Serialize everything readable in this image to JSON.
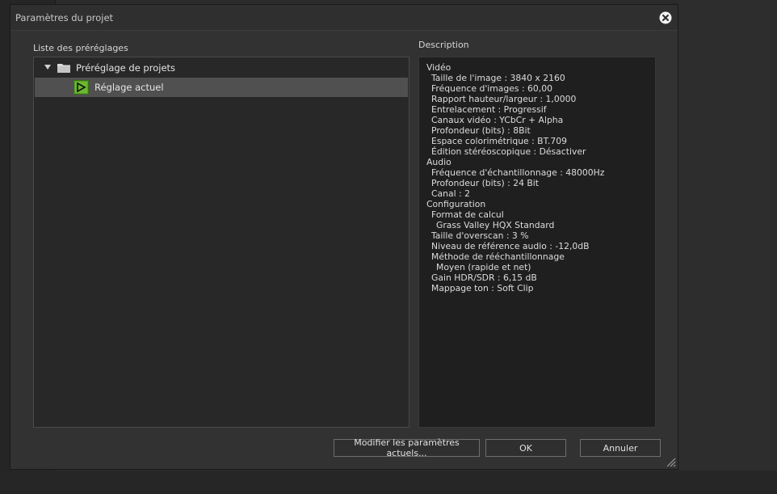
{
  "dialog": {
    "title": "Paramètres du projet"
  },
  "presets": {
    "label": "Liste des préréglages",
    "root": {
      "label": "Préréglage de projets",
      "icon": "folder-icon",
      "expanded": true
    },
    "selected": {
      "label": "Réglage actuel",
      "icon": "preset-icon"
    }
  },
  "description": {
    "label": "Description",
    "lines": [
      {
        "text": "Vidéo",
        "level": 0
      },
      {
        "text": "Taille de l'image : 3840 x 2160",
        "level": 1
      },
      {
        "text": "Fréquence d'images : 60,00",
        "level": 1
      },
      {
        "text": "Rapport hauteur/largeur : 1,0000",
        "level": 1
      },
      {
        "text": "Entrelacement : Progressif",
        "level": 1
      },
      {
        "text": "Canaux vidéo : YCbCr + Alpha",
        "level": 1
      },
      {
        "text": "Profondeur (bits) : 8Bit",
        "level": 1
      },
      {
        "text": "Espace colorimétrique : BT.709",
        "level": 1
      },
      {
        "text": "Édition stéréoscopique : Désactiver",
        "level": 1
      },
      {
        "text": "Audio",
        "level": 0
      },
      {
        "text": "Fréquence d'échantillonnage : 48000Hz",
        "level": 1
      },
      {
        "text": "Profondeur (bits) : 24 Bit",
        "level": 1
      },
      {
        "text": "Canal : 2",
        "level": 1
      },
      {
        "text": "Configuration",
        "level": 0
      },
      {
        "text": "Format de calcul",
        "level": 1
      },
      {
        "text": "Grass Valley HQX Standard",
        "level": 2
      },
      {
        "text": "Taille d'overscan : 3 %",
        "level": 1
      },
      {
        "text": "Niveau de référence audio : -12,0dB",
        "level": 1
      },
      {
        "text": "Méthode de rééchantillonnage",
        "level": 1
      },
      {
        "text": "Moyen (rapide et net)",
        "level": 2
      },
      {
        "text": "Gain HDR/SDR : 6,15 dB",
        "level": 1
      },
      {
        "text": "Mappage ton : Soft Clip",
        "level": 1
      }
    ]
  },
  "buttons": {
    "modify": "Modifier les paramètres actuels...",
    "ok": "OK",
    "cancel": "Annuler"
  },
  "icons": {
    "close": "close-icon",
    "resize": "resize-grip-icon"
  },
  "colors": {
    "selection": "#505050",
    "preset_icon": "#5a9e2a"
  }
}
